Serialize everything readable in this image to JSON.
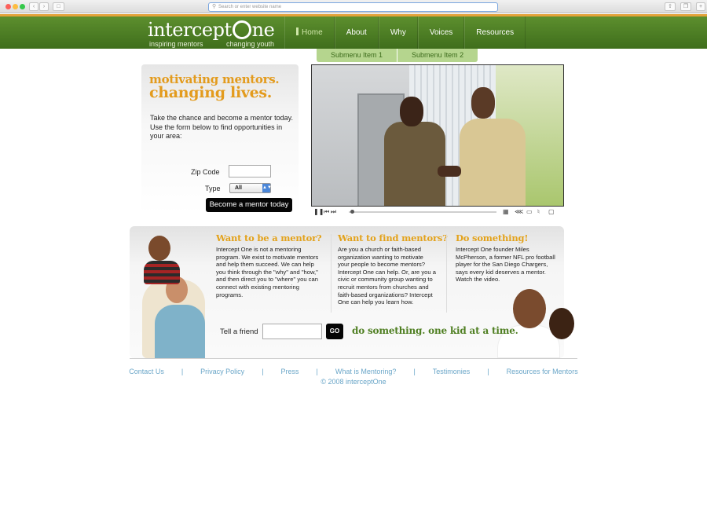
{
  "browser": {
    "url_placeholder": "Search or enter website name"
  },
  "header": {
    "logo_word_a": "intercept",
    "logo_word_b": "ne",
    "tagline_left": "inspiring mentors",
    "tagline_right": "changing youth",
    "nav": [
      "Home",
      "About",
      "Why",
      "Voices",
      "Resources"
    ],
    "active_nav": "Home"
  },
  "submenu": [
    "Submenu Item 1",
    "Submenu Item 2"
  ],
  "promo": {
    "headline_1": "motivating mentors.",
    "headline_2": "changing lives.",
    "intro": "Take the chance and become a mentor today. Use the form below to find opportunities in your area:",
    "zip_label": "Zip Code",
    "zip_value": "",
    "type_label": "Type",
    "type_selected": "All",
    "cta": "Become a mentor today"
  },
  "columns": [
    {
      "heading": "Want to be a mentor?",
      "body": "Intercept One is not a mentoring program. We exist to motivate mentors and help them succeed. We can help you think through the \"why\" and \"how,\" and then direct you to \"where\" you can connect with existing mentoring programs."
    },
    {
      "heading": "Want to find mentors?",
      "body": "Are you a church or faith-based organization wanting to motivate your people to become mentors? Intercept One can help. Or, are you a civic or community group wanting to recruit mentors from churches and faith-based organizations? Intercept One can help you learn how."
    },
    {
      "heading": "Do something!",
      "body": "Intercept One founder Miles McPherson, a former NFL pro football player for the San Diego Chargers, says every kid deserves a mentor. Watch the video."
    }
  ],
  "friend": {
    "label": "Tell a friend",
    "value": "",
    "go": "GO"
  },
  "slogan": "do something. one kid at a time.",
  "footer": {
    "links": [
      "Contact Us",
      "Privacy Policy",
      "Press",
      "What is Mentoring?",
      "Testimonies",
      "Resources for Mentors"
    ],
    "separator": "|",
    "copyright": "© 2008 interceptOne"
  },
  "colors": {
    "header_green": "#4a7b23",
    "accent_orange": "#e3a23a",
    "heading_gold": "#e3a21b",
    "submenu_green": "#b5d58e",
    "link_blue": "#6aa6c8"
  }
}
